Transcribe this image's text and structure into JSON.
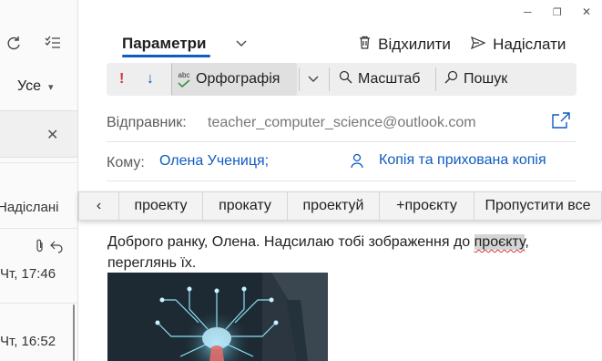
{
  "left_pane": {
    "filter_label": "Усе",
    "sent_label": "Надіслані",
    "msg1_time": "Чт, 17:46",
    "msg2_time": "Чт, 16:52"
  },
  "header": {
    "tab_label": "Параметри",
    "discard_label": "Відхилити",
    "send_label": "Надіслати"
  },
  "toolbar": {
    "importance_glyph": "!",
    "low_importance_glyph": "↓",
    "spelling_label": "Орфографія",
    "spelling_abc": "abc",
    "zoom_label": "Масштаб",
    "search_label": "Пошук"
  },
  "fields": {
    "from_label": "Відправник:",
    "from_value": "teacher_computer_science@outlook.com",
    "to_label": "Кому:",
    "to_value": "Олена Учениця;",
    "cc_label": "Копія та прихована копія"
  },
  "suggestions": {
    "back": "‹",
    "items": [
      "проекту",
      "прокату",
      "проектуй",
      "+проєкту",
      "Пропустити все"
    ]
  },
  "body": {
    "text_before": "Доброго ранку, Олена. Надсилаю тобі зображення до ",
    "misspelled_word": "проєкту",
    "text_after": ", переглянь їх."
  },
  "colors": {
    "accent": "#0f5cbf",
    "importance": "#d13438",
    "link": "#0f5cbf"
  }
}
